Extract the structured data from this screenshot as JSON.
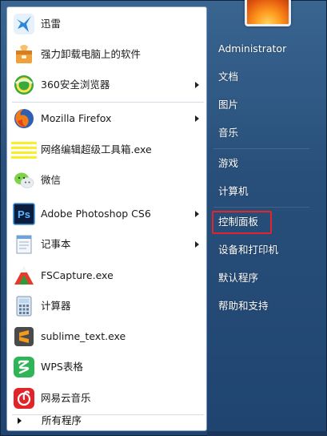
{
  "programs": [
    {
      "id": "xunlei",
      "label": "迅雷",
      "icon": "xunlei-bird-icon",
      "submenu": false
    },
    {
      "id": "uninstall",
      "label": "强力卸载电脑上的软件",
      "icon": "uninstall-box-icon",
      "submenu": false
    },
    {
      "id": "browser360",
      "label": "360安全浏览器",
      "icon": "browser-360-icon",
      "submenu": true
    },
    {
      "id": "firefox",
      "label": "Mozilla Firefox",
      "icon": "firefox-icon",
      "submenu": true
    },
    {
      "id": "webedit",
      "label": "网络编辑超级工具箱.exe",
      "icon": "yellow-lines-icon",
      "submenu": false
    },
    {
      "id": "wechat",
      "label": "微信",
      "icon": "wechat-icon",
      "submenu": false
    },
    {
      "id": "photoshop",
      "label": "Adobe Photoshop CS6",
      "icon": "photoshop-icon",
      "submenu": true
    },
    {
      "id": "notepad",
      "label": "记事本",
      "icon": "notepad-icon",
      "submenu": true
    },
    {
      "id": "fscapture",
      "label": "FSCapture.exe",
      "icon": "fscapture-icon",
      "submenu": false
    },
    {
      "id": "calculator",
      "label": "计算器",
      "icon": "calculator-icon",
      "submenu": false
    },
    {
      "id": "sublime",
      "label": "sublime_text.exe",
      "icon": "sublime-icon",
      "submenu": false
    },
    {
      "id": "wps",
      "label": "WPS表格",
      "icon": "wps-sheet-icon",
      "submenu": false
    },
    {
      "id": "netease",
      "label": "网易云音乐",
      "icon": "netease-music-icon",
      "submenu": false
    }
  ],
  "all_programs_label": "所有程序",
  "right_pane": {
    "user": "Administrator",
    "items": [
      "文档",
      "图片",
      "音乐",
      "游戏",
      "计算机",
      "控制面板",
      "设备和打印机",
      "默认程序",
      "帮助和支持"
    ],
    "highlighted_item": "控制面板"
  },
  "colors": {
    "highlight_border": "#e4242b",
    "pane_bg": "#ffffff",
    "menu_bg": "#2d5581"
  }
}
